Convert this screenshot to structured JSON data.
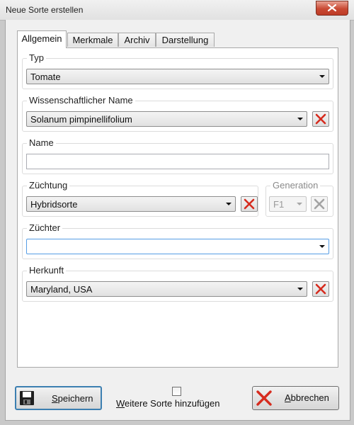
{
  "window": {
    "title": "Neue Sorte erstellen"
  },
  "tabs": [
    {
      "label": "Allgemein",
      "active": true
    },
    {
      "label": "Merkmale",
      "active": false
    },
    {
      "label": "Archiv",
      "active": false
    },
    {
      "label": "Darstellung",
      "active": false
    }
  ],
  "form": {
    "typ": {
      "legend": "Typ",
      "value": "Tomate"
    },
    "wissenschaftlicher_name": {
      "legend": "Wissenschaftlicher Name",
      "value": "Solanum pimpinellifolium"
    },
    "name": {
      "legend": "Name",
      "value": ""
    },
    "zuechtung": {
      "legend": "Züchtung",
      "value": "Hybridsorte"
    },
    "generation": {
      "legend": "Generation",
      "value": "F1",
      "enabled": false
    },
    "zuechter": {
      "legend": "Züchter",
      "value": ""
    },
    "herkunft": {
      "legend": "Herkunft",
      "value": "Maryland, USA"
    }
  },
  "footer": {
    "save": {
      "accel": "S",
      "rest": "peichern"
    },
    "more": {
      "accel": "W",
      "rest": "eitere Sorte hinzufügen",
      "checked": false
    },
    "cancel": {
      "accel": "A",
      "rest": "bbrechen"
    }
  },
  "colors": {
    "clear_icon_red": "#d62b1e",
    "default_button_border": "#3c7fb1",
    "titlebar_close": "#c94a34"
  },
  "icons": {
    "close": "close-icon",
    "clear": "clear-red-x-icon",
    "save": "floppy-disk-icon",
    "cancel": "cancel-red-x-icon"
  }
}
